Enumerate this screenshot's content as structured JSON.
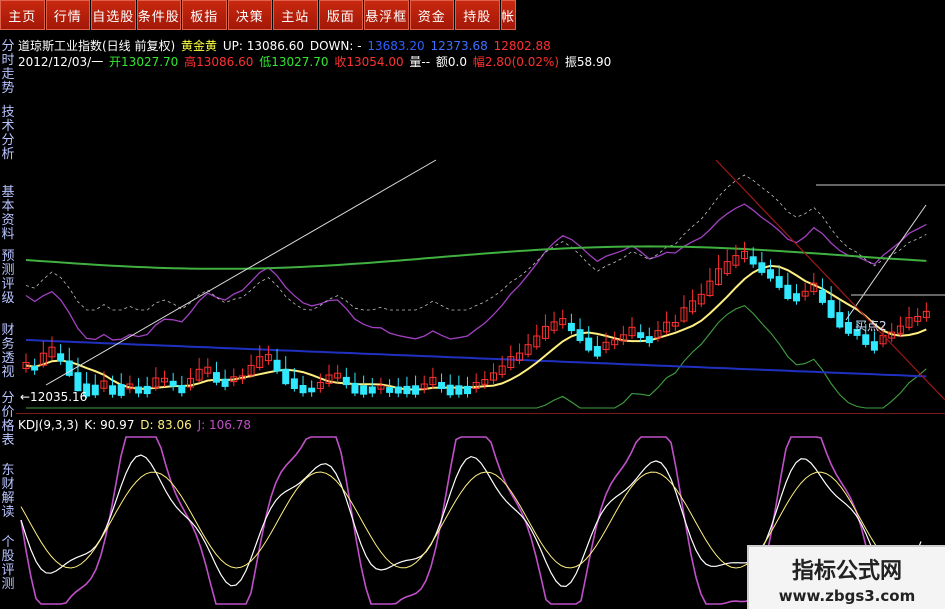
{
  "menu": [
    "主页",
    "行情",
    "自选股",
    "条件股",
    "板指",
    "决策",
    "主站",
    "版面",
    "悬浮框",
    "资金",
    "持股",
    "帐"
  ],
  "side_tabs": [
    "分时走势",
    "技术分析",
    "基本资料",
    "预测评级",
    "财务透视",
    "分价格表",
    "东财解读",
    "个股评测"
  ],
  "info": {
    "name": "道琼斯工业指数(日线 前复权)",
    "mode": "黄金黄",
    "up": "UP: 13086.60",
    "down": "DOWN: -",
    "v1": "13683.20",
    "v2": "12373.68",
    "v3": "12802.88",
    "date": "2012/12/03/一",
    "open": "开13027.70",
    "high": "高13086.60",
    "low": "低13027.70",
    "close": "收13054.00",
    "vol": "量--",
    "amt": "额0.0",
    "chg": "幅2.80(0.02%)",
    "amp": "振58.90"
  },
  "kdj": {
    "name": "KDJ(9,3,3)",
    "k": "K: 90.97",
    "d": "D: 83.06",
    "j": "J: 106.78"
  },
  "labels": {
    "low": "←12035.16",
    "buy": "买点2"
  },
  "watermark": {
    "title": "指标公式网",
    "url": "www.zbgs3.com"
  },
  "colors": {
    "up": "#ff3030",
    "down": "#30e8ff",
    "k": "#ffffff",
    "d": "#ffef80",
    "j": "#c050c8"
  }
}
